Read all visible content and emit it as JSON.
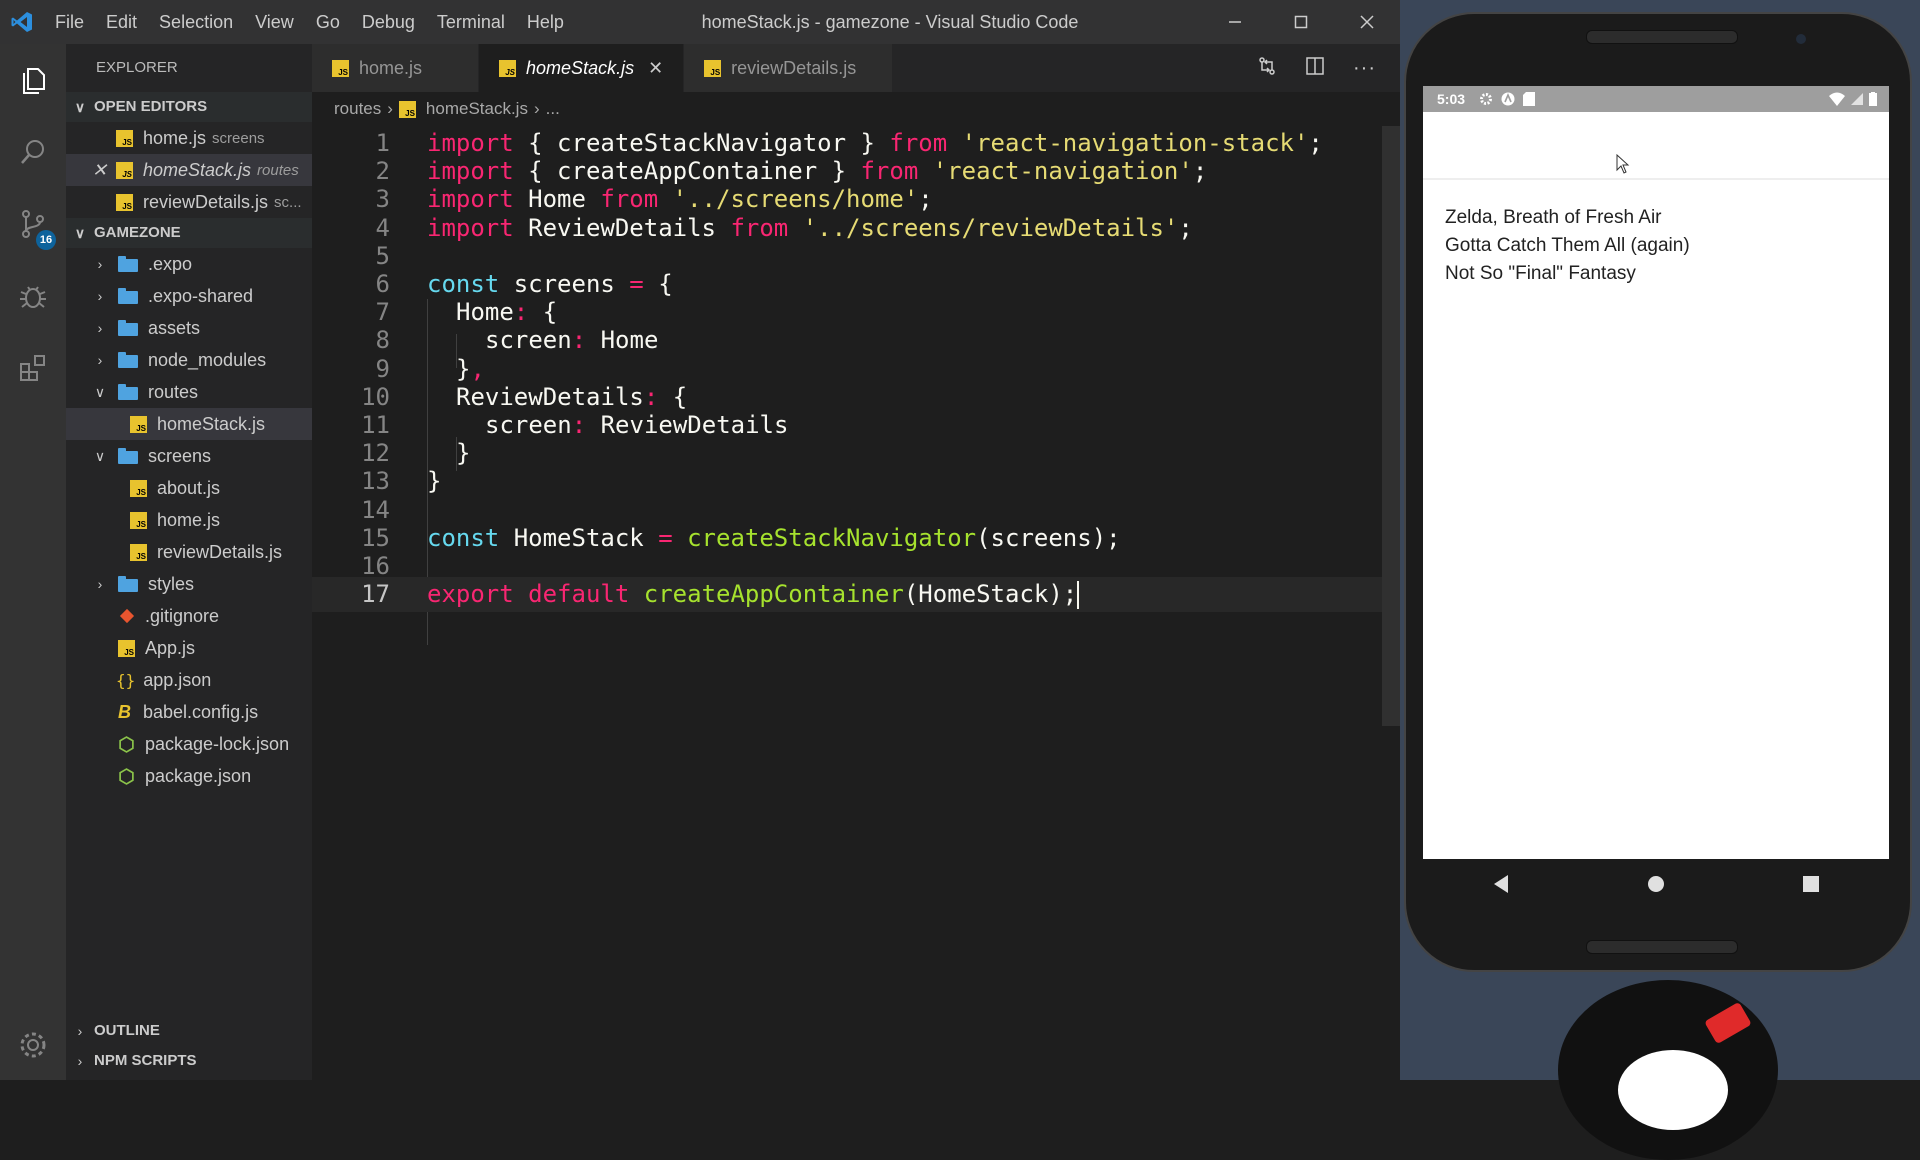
{
  "window": {
    "title": "homeStack.js - gamezone - Visual Studio Code",
    "menu": [
      "File",
      "Edit",
      "Selection",
      "View",
      "Go",
      "Debug",
      "Terminal",
      "Help"
    ]
  },
  "activity": {
    "scm_badge": "16"
  },
  "sidebar": {
    "title": "EXPLORER",
    "open_editors_label": "OPEN EDITORS",
    "open_editors": [
      {
        "name": "home.js",
        "hint": "screens"
      },
      {
        "name": "homeStack.js",
        "hint": "routes"
      },
      {
        "name": "reviewDetails.js",
        "hint": "sc..."
      }
    ],
    "project_label": "GAMEZONE",
    "tree": [
      {
        "name": ".expo"
      },
      {
        "name": ".expo-shared"
      },
      {
        "name": "assets"
      },
      {
        "name": "node_modules"
      },
      {
        "name": "routes"
      },
      {
        "name": "homeStack.js"
      },
      {
        "name": "screens"
      },
      {
        "name": "about.js"
      },
      {
        "name": "home.js"
      },
      {
        "name": "reviewDetails.js"
      },
      {
        "name": "styles"
      },
      {
        "name": ".gitignore"
      },
      {
        "name": "App.js"
      },
      {
        "name": "app.json"
      },
      {
        "name": "babel.config.js"
      },
      {
        "name": "package-lock.json"
      },
      {
        "name": "package.json"
      }
    ],
    "outline_label": "OUTLINE",
    "npm_label": "NPM SCRIPTS"
  },
  "tabs": [
    {
      "label": "home.js"
    },
    {
      "label": "homeStack.js"
    },
    {
      "label": "reviewDetails.js"
    }
  ],
  "breadcrumb": {
    "folder": "routes",
    "file": "homeStack.js",
    "more": "..."
  },
  "editor": {
    "line_numbers": [
      "1",
      "2",
      "3",
      "4",
      "5",
      "6",
      "7",
      "8",
      "9",
      "10",
      "11",
      "12",
      "13",
      "14",
      "15",
      "16",
      "17"
    ],
    "l1": {
      "a": "import",
      "b": " { createStackNavigator } ",
      "c": "from",
      "d": " ",
      "e": "'react-navigation-stack'",
      "f": ";"
    },
    "l2": {
      "a": "import",
      "b": " { createAppContainer } ",
      "c": "from",
      "d": " ",
      "e": "'react-navigation'",
      "f": ";"
    },
    "l3": {
      "a": "import",
      "b": " Home ",
      "c": "from",
      "d": " ",
      "e": "'../screens/home'",
      "f": ";"
    },
    "l4": {
      "a": "import",
      "b": " ReviewDetails ",
      "c": "from",
      "d": " ",
      "e": "'../screens/reviewDetails'",
      "f": ";"
    },
    "l6": {
      "a": "const",
      "b": " screens ",
      "c": "=",
      "d": " {"
    },
    "l7": {
      "a": "Home",
      "b": ":",
      "c": " {"
    },
    "l8": {
      "a": "screen",
      "b": ":",
      "c": " Home"
    },
    "l9": {
      "a": "}",
      "b": ","
    },
    "l10": {
      "a": "ReviewDetails",
      "b": ":",
      "c": " {"
    },
    "l11": {
      "a": "screen",
      "b": ":",
      "c": " ReviewDetails"
    },
    "l12": {
      "a": "}"
    },
    "l13": {
      "a": "}"
    },
    "l15": {
      "a": "const",
      "b": " HomeStack ",
      "c": "=",
      "d": " ",
      "e": "createStackNavigator",
      "f": "(screens);"
    },
    "l17": {
      "a": "export",
      "b": " ",
      "c": "default",
      "d": " ",
      "e": "createAppContainer",
      "f": "(HomeStack);"
    }
  },
  "phone": {
    "time": "5:03",
    "games": [
      "Zelda, Breath of Fresh Air",
      "Gotta Catch Them All (again)",
      "Not So \"Final\" Fantasy"
    ]
  },
  "colors": {
    "keyword": "#f92672",
    "keyword_blue": "#66d9ef",
    "string": "#e6db74",
    "function": "#a6e22e",
    "badge": "#0e639c"
  }
}
